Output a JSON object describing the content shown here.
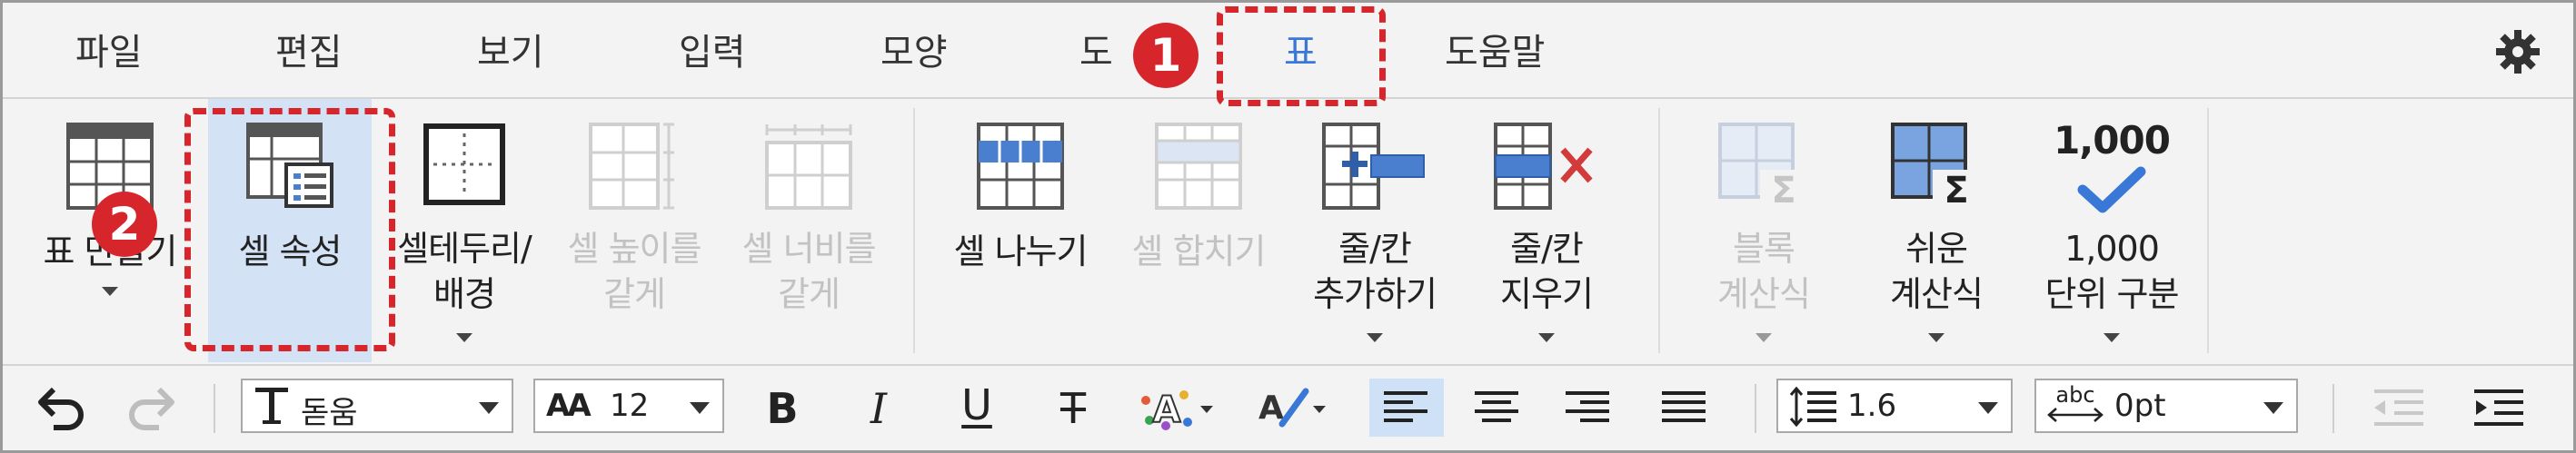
{
  "tabs": [
    {
      "label": "파일",
      "active": false
    },
    {
      "label": "편집",
      "active": false
    },
    {
      "label": "보기",
      "active": false
    },
    {
      "label": "입력",
      "active": false
    },
    {
      "label": "모양",
      "active": false
    },
    {
      "label": "도",
      "active": false
    },
    {
      "label": "표",
      "active": true
    },
    {
      "label": "도움말",
      "active": false
    }
  ],
  "ribbon": {
    "table_label": "표 만들기",
    "cell_props_label": "셀 속성",
    "cell_border_label_1": "셀테두리/",
    "cell_border_label_2": "배경",
    "row_height_label_1": "셀 높이를",
    "row_height_label_2": "같게",
    "col_width_label_1": "셀 너비를",
    "col_width_label_2": "같게",
    "split_label": "셀 나누기",
    "merge_label": "셀 합치기",
    "insert_label_1": "줄/칸",
    "insert_label_2": "추가하기",
    "delete_label_1": "줄/칸",
    "delete_label_2": "지우기",
    "block_calc_label_1": "블록",
    "block_calc_label_2": "계산식",
    "easy_calc_label_1": "쉬운",
    "easy_calc_label_2": "계산식",
    "thousands_icon_text": "1,000",
    "thousands_label_1": "1,000",
    "thousands_label_2": "단위 구분"
  },
  "toolbar": {
    "font_name": "돋움",
    "font_size": "12",
    "font_size_icon": "AA",
    "bold": "B",
    "italic": "I",
    "underline": "U",
    "strike": "T",
    "line_spacing": "1.6",
    "char_spacing_icon": "abc",
    "char_spacing": "0pt"
  },
  "callouts": {
    "one": "1",
    "two": "2"
  },
  "colors": {
    "accent": "#3a78d8",
    "callout": "#d6262b",
    "selected_bg": "#d3e2f4",
    "icon_blue": "#4a7fd0"
  }
}
